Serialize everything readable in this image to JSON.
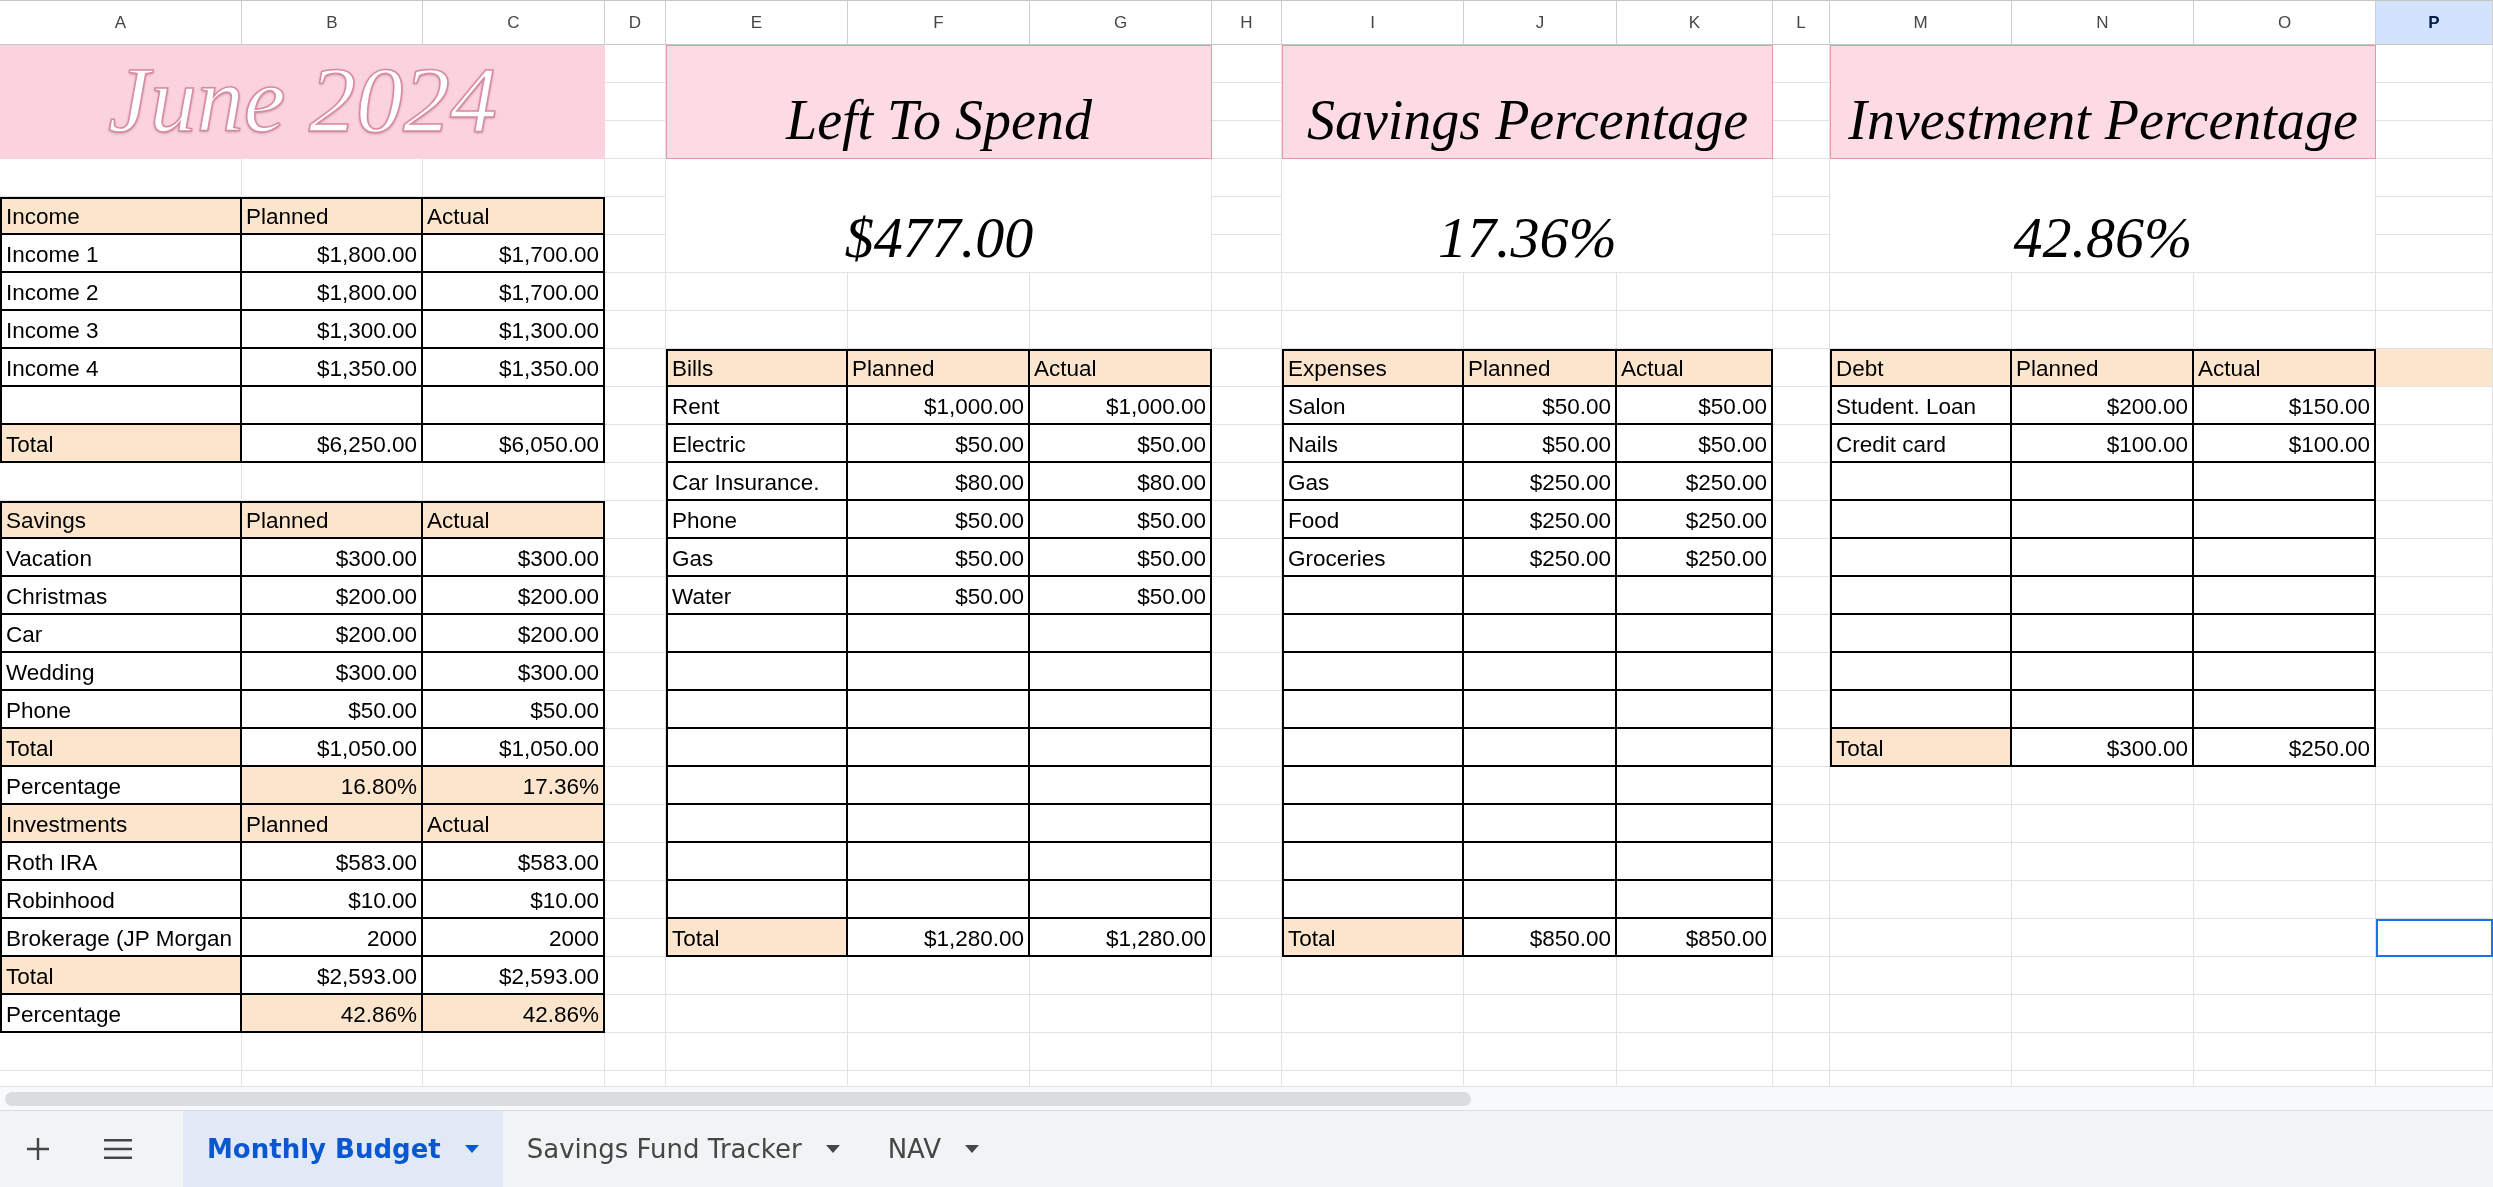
{
  "columns": [
    {
      "label": "A",
      "selected": false
    },
    {
      "label": "B",
      "selected": false
    },
    {
      "label": "C",
      "selected": false
    },
    {
      "label": "D",
      "selected": false
    },
    {
      "label": "E",
      "selected": false
    },
    {
      "label": "F",
      "selected": false
    },
    {
      "label": "G",
      "selected": false
    },
    {
      "label": "H",
      "selected": false
    },
    {
      "label": "I",
      "selected": false
    },
    {
      "label": "J",
      "selected": false
    },
    {
      "label": "K",
      "selected": false
    },
    {
      "label": "L",
      "selected": false
    },
    {
      "label": "M",
      "selected": false
    },
    {
      "label": "N",
      "selected": false
    },
    {
      "label": "O",
      "selected": false
    },
    {
      "label": "P",
      "selected": true
    }
  ],
  "blocks": [
    {
      "kind": "month",
      "title": "June 2024",
      "tables": [
        {
          "rows": [
            {
              "kind": "header",
              "cells": [
                "Income",
                "Planned",
                "Actual"
              ]
            },
            {
              "kind": "item",
              "cells": [
                "Income 1",
                "$1,800.00",
                "$1,700.00"
              ]
            },
            {
              "kind": "item",
              "cells": [
                "Income 2",
                "$1,800.00",
                "$1,700.00"
              ]
            },
            {
              "kind": "item",
              "cells": [
                "Income 3",
                "$1,300.00",
                "$1,300.00"
              ]
            },
            {
              "kind": "item",
              "cells": [
                "Income 4",
                "$1,350.00",
                "$1,350.00"
              ]
            },
            {
              "kind": "blank"
            },
            {
              "kind": "total",
              "cells": [
                "Total",
                "$6,250.00",
                "$6,050.00"
              ]
            }
          ]
        },
        {
          "rows": [
            {
              "kind": "header",
              "cells": [
                "Savings",
                "Planned",
                "Actual"
              ]
            },
            {
              "kind": "item",
              "cells": [
                "Vacation",
                "$300.00",
                "$300.00"
              ]
            },
            {
              "kind": "item",
              "cells": [
                "Christmas",
                "$200.00",
                "$200.00"
              ]
            },
            {
              "kind": "item",
              "cells": [
                "Car",
                "$200.00",
                "$200.00"
              ]
            },
            {
              "kind": "item",
              "cells": [
                "Wedding",
                "$300.00",
                "$300.00"
              ]
            },
            {
              "kind": "item",
              "cells": [
                "Phone",
                "$50.00",
                "$50.00"
              ]
            },
            {
              "kind": "total",
              "cells": [
                "Total",
                "$1,050.00",
                "$1,050.00"
              ]
            },
            {
              "kind": "percentage",
              "cells": [
                "Percentage",
                "16.80%",
                "17.36%"
              ]
            }
          ]
        },
        {
          "rows": [
            {
              "kind": "header",
              "cells": [
                "Investments",
                "Planned",
                "Actual"
              ]
            },
            {
              "kind": "item",
              "cells": [
                "Roth IRA",
                "$583.00",
                "$583.00"
              ]
            },
            {
              "kind": "item",
              "cells": [
                "Robinhood",
                "$10.00",
                "$10.00"
              ]
            },
            {
              "kind": "item",
              "cells": [
                "Brokerage (JP Morgan",
                "2000",
                "2000"
              ]
            },
            {
              "kind": "total",
              "cells": [
                "Total",
                "$2,593.00",
                "$2,593.00"
              ]
            },
            {
              "kind": "percentage",
              "cells": [
                "Percentage",
                "42.86%",
                "42.86%"
              ]
            }
          ]
        }
      ]
    },
    {
      "kind": "summary",
      "title": "Left To Spend",
      "value": "$477.00",
      "tables": [
        {
          "rows": [
            {
              "kind": "header",
              "cells": [
                "Bills",
                "Planned",
                "Actual"
              ]
            },
            {
              "kind": "item",
              "cells": [
                "Rent",
                "$1,000.00",
                "$1,000.00"
              ]
            },
            {
              "kind": "item",
              "cells": [
                "Electric",
                "$50.00",
                "$50.00"
              ]
            },
            {
              "kind": "item",
              "cells": [
                "Car Insurance.",
                "$80.00",
                "$80.00"
              ]
            },
            {
              "kind": "item",
              "cells": [
                "Phone",
                "$50.00",
                "$50.00"
              ]
            },
            {
              "kind": "item",
              "cells": [
                "Gas",
                "$50.00",
                "$50.00"
              ]
            },
            {
              "kind": "item",
              "cells": [
                "Water",
                "$50.00",
                "$50.00"
              ]
            },
            {
              "kind": "blank"
            },
            {
              "kind": "blank"
            },
            {
              "kind": "blank"
            },
            {
              "kind": "blank"
            },
            {
              "kind": "blank"
            },
            {
              "kind": "blank"
            },
            {
              "kind": "blank"
            },
            {
              "kind": "blank"
            },
            {
              "kind": "total",
              "cells": [
                "Total",
                "$1,280.00",
                "$1,280.00"
              ]
            }
          ]
        }
      ]
    },
    {
      "kind": "summary",
      "title": "Savings Percentage",
      "value": "17.36%",
      "tables": [
        {
          "rows": [
            {
              "kind": "header",
              "cells": [
                "Expenses",
                "Planned",
                "Actual"
              ]
            },
            {
              "kind": "item",
              "cells": [
                "Salon",
                "$50.00",
                "$50.00"
              ]
            },
            {
              "kind": "item",
              "cells": [
                "Nails",
                "$50.00",
                "$50.00"
              ]
            },
            {
              "kind": "item",
              "cells": [
                "Gas",
                "$250.00",
                "$250.00"
              ]
            },
            {
              "kind": "item",
              "cells": [
                "Food",
                "$250.00",
                "$250.00"
              ]
            },
            {
              "kind": "item",
              "cells": [
                "Groceries",
                "$250.00",
                "$250.00"
              ]
            },
            {
              "kind": "blank"
            },
            {
              "kind": "blank"
            },
            {
              "kind": "blank"
            },
            {
              "kind": "blank"
            },
            {
              "kind": "blank"
            },
            {
              "kind": "blank"
            },
            {
              "kind": "blank"
            },
            {
              "kind": "blank"
            },
            {
              "kind": "blank"
            },
            {
              "kind": "total",
              "cells": [
                "Total",
                "$850.00",
                "$850.00"
              ]
            }
          ]
        }
      ]
    },
    {
      "kind": "summary",
      "title": "Investment Percentage",
      "value": "42.86%",
      "tables": [
        {
          "rows": [
            {
              "kind": "header",
              "cells": [
                "Debt",
                "Planned",
                "Actual"
              ],
              "trailing_fill": true
            },
            {
              "kind": "item",
              "cells": [
                "Student. Loan",
                "$200.00",
                "$150.00"
              ]
            },
            {
              "kind": "item",
              "cells": [
                "Credit card",
                "$100.00",
                "$100.00"
              ]
            },
            {
              "kind": "blank"
            },
            {
              "kind": "blank"
            },
            {
              "kind": "blank"
            },
            {
              "kind": "blank"
            },
            {
              "kind": "blank"
            },
            {
              "kind": "blank"
            },
            {
              "kind": "blank"
            },
            {
              "kind": "total",
              "cells": [
                "Total",
                "$300.00",
                "$250.00"
              ]
            }
          ]
        }
      ]
    }
  ],
  "tabs": [
    {
      "label": "Monthly Budget",
      "selected": true
    },
    {
      "label": "Savings Fund Tracker",
      "selected": false
    },
    {
      "label": "NAV",
      "selected": false
    }
  ]
}
